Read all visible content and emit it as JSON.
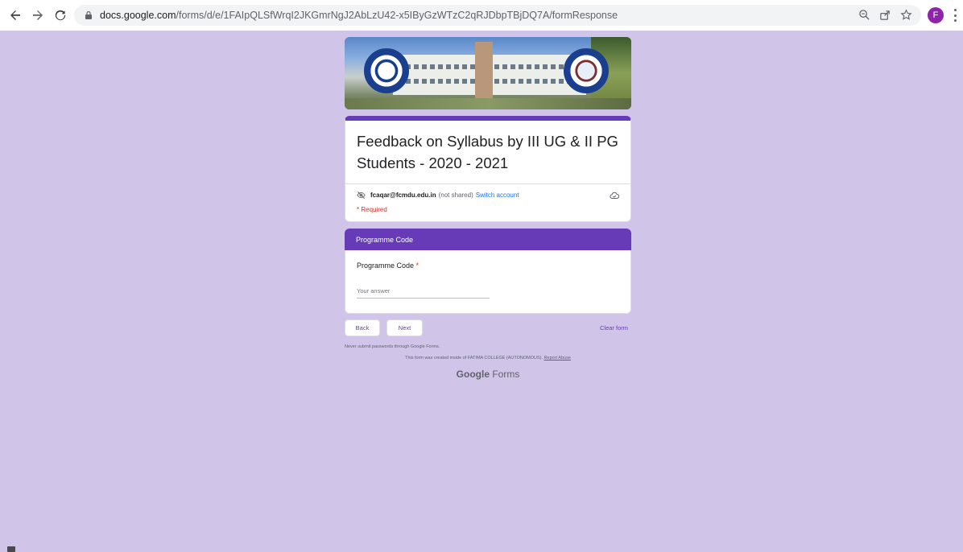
{
  "browser": {
    "url_host": "docs.google.com",
    "url_path": "/forms/d/e/1FAIpQLSfWrqI2JKGmrNgJ2AbLzU42-x5IByGzWTzC2qRJDbpTBjDQ7A/formResponse",
    "profile_initial": "F",
    "colors": {
      "profile": "#8e24aa"
    }
  },
  "form": {
    "title": "Feedback on Syllabus by III UG & II PG Students - 2020 - 2021",
    "account_email": "fcaqar@fcmdu.edu.in",
    "not_shared": "(not shared)",
    "switch_account": "Switch account",
    "required_note": "* Required",
    "section_title": "Programme Code",
    "question_label": "Programme Code",
    "question_required_star": "*",
    "answer_placeholder": "Your answer",
    "back_label": "Back",
    "next_label": "Next",
    "clear_label": "Clear form",
    "colors": {
      "accent": "#673ab7",
      "background": "#d1c4e9",
      "required": "#d93025"
    }
  },
  "footer": {
    "password_note": "Never submit passwords through Google Forms.",
    "created_text": "This form was created inside of FATIMA COLLEGE (AUTONOMOUS).",
    "report_abuse": "Report Abuse",
    "brand_google": "Google",
    "brand_forms": "Forms"
  }
}
